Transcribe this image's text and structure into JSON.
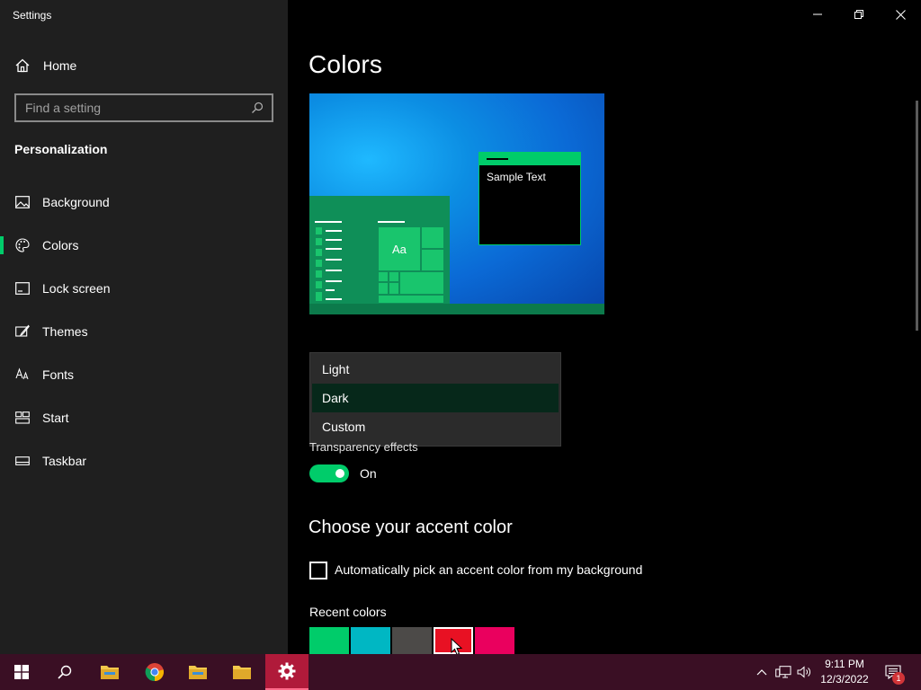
{
  "window": {
    "title": "Settings"
  },
  "sidebar": {
    "home_label": "Home",
    "search_placeholder": "Find a setting",
    "section_title": "Personalization",
    "items": [
      {
        "label": "Background",
        "icon": "image-icon"
      },
      {
        "label": "Colors",
        "icon": "palette-icon",
        "active": true
      },
      {
        "label": "Lock screen",
        "icon": "lock-screen-icon"
      },
      {
        "label": "Themes",
        "icon": "brush-icon"
      },
      {
        "label": "Fonts",
        "icon": "font-icon"
      },
      {
        "label": "Start",
        "icon": "start-icon"
      },
      {
        "label": "Taskbar",
        "icon": "taskbar-icon"
      }
    ]
  },
  "main": {
    "title": "Colors",
    "preview": {
      "sample_text": "Sample Text",
      "tile_text": "Aa"
    },
    "mode_dropdown": {
      "options": [
        "Light",
        "Dark",
        "Custom"
      ],
      "selected": "Dark"
    },
    "transparency": {
      "label": "Transparency effects",
      "state": "On",
      "enabled": true
    },
    "accent_heading": "Choose your accent color",
    "auto_accent_label": "Automatically pick an accent color from my background",
    "auto_accent_checked": false,
    "recent_colors_label": "Recent colors",
    "recent_colors": [
      "#00cc6a",
      "#00b7c3",
      "#4c4a48",
      "#e81123",
      "#ea005e"
    ],
    "selected_recent_color": "#e81123"
  },
  "taskbar": {
    "apps": [
      "start-icon",
      "search-icon",
      "file-explorer-icon",
      "chrome-icon",
      "file-explorer-icon",
      "file-explorer-icon",
      "settings-icon"
    ],
    "clock_time": "9:11 PM",
    "clock_date": "12/3/2022",
    "notification_count": "1"
  },
  "colors": {
    "accent": "#00cc6a",
    "sidebar_bg": "#1f1f1f",
    "taskbar_bg": "#3a0f24",
    "active_taskbar_app": "#b01a3a"
  }
}
